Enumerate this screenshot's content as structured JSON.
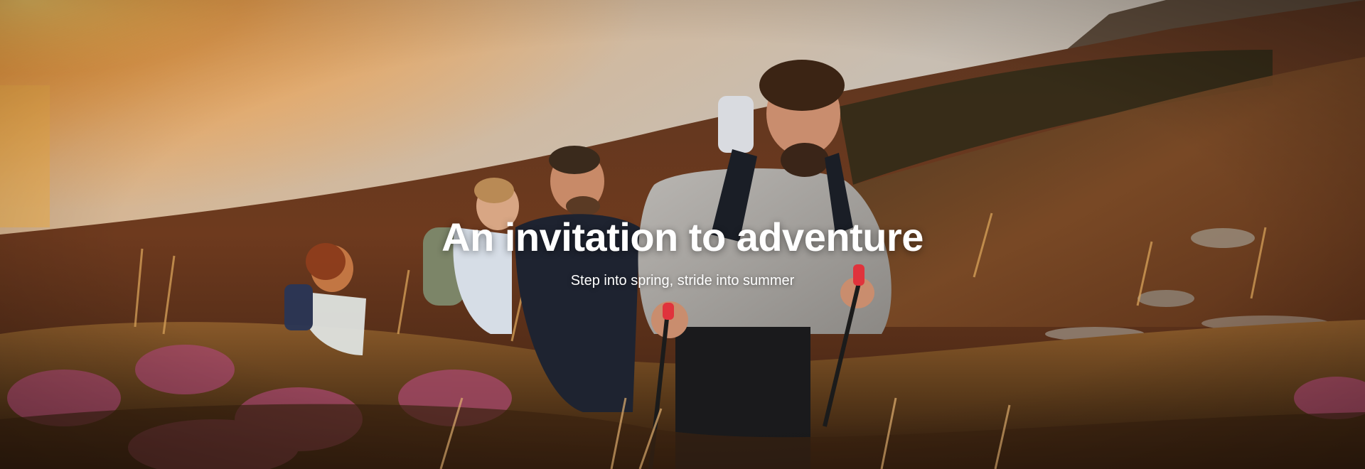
{
  "hero": {
    "title": "An invitation to adventure",
    "subtitle": "Step into spring, stride into summer",
    "image_subject": "hikers-on-heather-hillside-at-sunset"
  },
  "colors": {
    "sky_glow": "#f0a44a",
    "sea": "#c9b7a0",
    "hillside": "#6b3b1f",
    "heather": "#a34a6a",
    "text": "#ffffff",
    "pole_accent": "#e0333c"
  }
}
